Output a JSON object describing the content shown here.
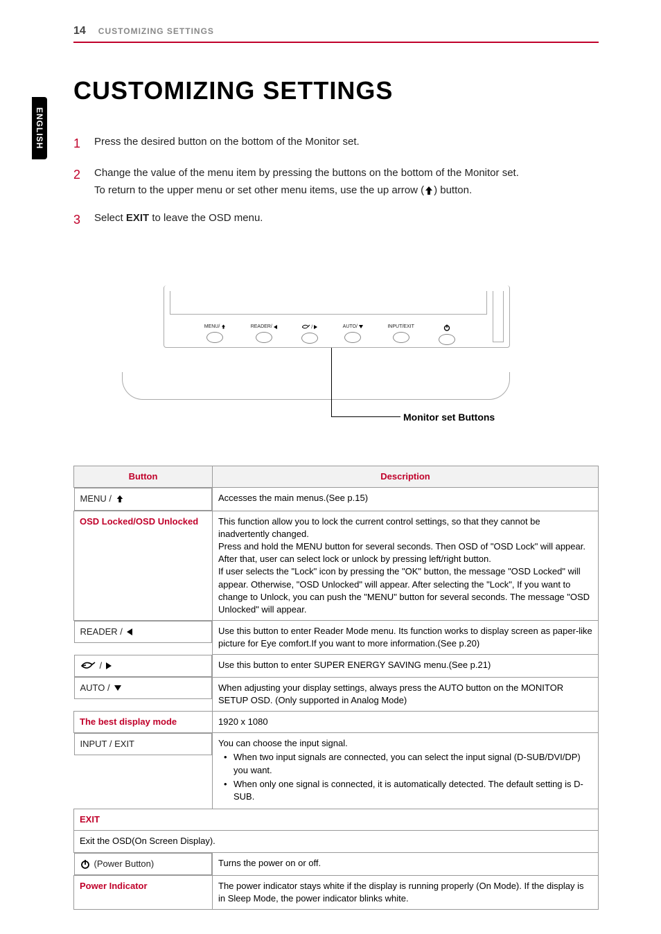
{
  "header": {
    "page_number": "14",
    "section": "CUSTOMIZING SETTINGS"
  },
  "lang_tab": "ENGLISH",
  "title": "CUSTOMIZING SETTINGS",
  "steps": {
    "s1": {
      "num": "1",
      "text": "Press the desired button on the bottom of the Monitor set."
    },
    "s2": {
      "num": "2",
      "line1": "Change the value of the menu item by pressing the buttons on the bottom of the Monitor set.",
      "line2a": "To return to the upper menu or set other menu items, use the up arrow (",
      "line2b": ") button."
    },
    "s3": {
      "num": "3",
      "prefix": "Select ",
      "bold": "EXIT",
      "suffix": " to leave the OSD menu."
    }
  },
  "figure": {
    "buttons": {
      "menu": "MENU/",
      "reader": "READER/",
      "eco": "/",
      "auto": "AUTO/",
      "input": "INPUT/EXIT"
    },
    "callout": "Monitor set Buttons"
  },
  "table": {
    "header_button": "Button",
    "header_desc": "Description",
    "menu": {
      "label": "MENU /",
      "desc1": "Accesses the main menus.(See p.15)",
      "sub_label": "OSD Locked/OSD Unlocked",
      "sub_desc": "This function allow you to lock the current control settings, so that they cannot be inadvertently changed.\nPress and hold the MENU button for several seconds. Then OSD of \"OSD Lock\" will appear. After that, user can select lock or unlock by pressing left/right button.\nIf user selects the \"Lock\" icon by pressing the \"OK\" button, the message \"OSD Locked\" will appear. Otherwise, \"OSD Unlocked\" will appear. After selecting the \"Lock\", If you want to change to Unlock, you can push the \"MENU\" button for several seconds. The message \"OSD Unlocked\" will appear."
    },
    "reader": {
      "label": "READER /",
      "desc": "Use this button to enter Reader Mode menu. Its function works to display screen as paper-like picture for Eye comfort.If you want to more information.(See p.20)"
    },
    "eco": {
      "label": "/",
      "desc": "Use this button to enter SUPER ENERGY SAVING menu.(See p.21)"
    },
    "auto": {
      "label": "AUTO /",
      "desc": "When adjusting your display settings, always press the AUTO button on the MONITOR SETUP OSD. (Only supported in Analog Mode)",
      "sub_label": "The best display mode",
      "sub_value": "1920 x 1080"
    },
    "input": {
      "label": "INPUT / EXIT",
      "intro": "You can choose the input signal.",
      "b1": "When two input signals are connected, you can select the input signal (D-SUB/DVI/DP) you want.",
      "b2": "When only one signal is connected, it is automatically detected. The default setting is D-SUB.",
      "exit_label": "EXIT",
      "exit_desc": "Exit the OSD(On Screen Display)."
    },
    "power": {
      "label": " (Power Button)",
      "desc1": "Turns the power on or off.",
      "sub_label": "Power Indicator",
      "sub_desc": "The power indicator stays white if the display is running properly (On Mode). If the display is in Sleep Mode, the power indicator blinks white."
    }
  }
}
